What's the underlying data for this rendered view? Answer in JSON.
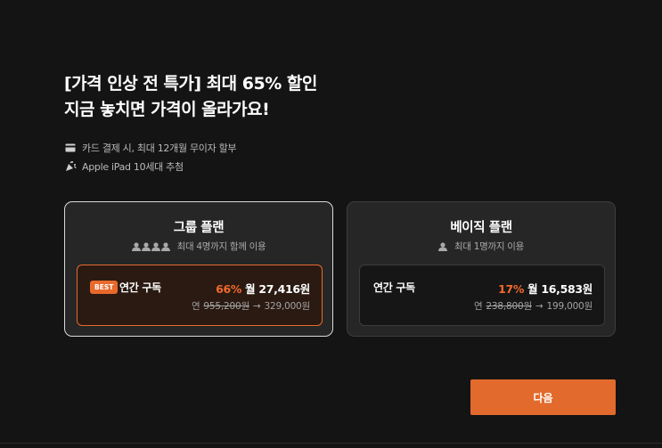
{
  "headline": {
    "line1": "[가격 인상 전 특가] 최대 65% 할인",
    "line2": "지금 놓치면 가격이 올라가요!"
  },
  "perks": [
    {
      "icon": "credit-card-icon",
      "text": "카드 결제 시, 최대 12개월 무이자 할부"
    },
    {
      "icon": "party-popper-icon",
      "text": "Apple iPad 10세대 추첨"
    }
  ],
  "plans": {
    "group": {
      "title": "그룹 플랜",
      "subtitle": "최대 4명까지 함께 이용",
      "selected": true,
      "option": {
        "badge": "BEST",
        "label": "연간 구독",
        "discount": "66%",
        "monthly": "월 27,416원",
        "year_prefix": "연",
        "original": "955,200원",
        "arrow": "→",
        "price": "329,000원"
      }
    },
    "basic": {
      "title": "베이직 플랜",
      "subtitle": "최대 1명까지 이용",
      "selected": false,
      "option": {
        "label": "연간 구독",
        "discount": "17%",
        "monthly": "월 16,583원",
        "year_prefix": "연",
        "original": "238,800원",
        "arrow": "→",
        "price": "199,000원"
      }
    }
  },
  "next_button": "다음",
  "colors": {
    "background": "#141414",
    "accent": "#e26a2c",
    "card": "#262626"
  }
}
